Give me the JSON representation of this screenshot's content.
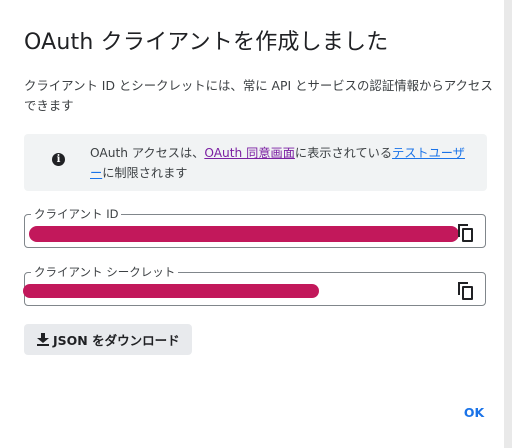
{
  "dialog": {
    "title": "OAuth クライアントを作成しました",
    "description": "クライアント ID とシークレットには、常に API とサービスの認証情報からアクセスできます"
  },
  "banner": {
    "icon": "info-icon",
    "text_before": "OAuth アクセスは、",
    "consent_link": "OAuth 同意画面",
    "text_middle": "に表示されている",
    "test_users_link": "テストユーザー",
    "text_after": "に制限されます",
    "colors": {
      "consent_link": "#7b1fa2",
      "test_users_link": "#1a73e8"
    }
  },
  "client_id": {
    "label": "クライアント ID",
    "value": "",
    "copy_icon": "copy-icon"
  },
  "client_secret": {
    "label": "クライアント シークレット",
    "value": "",
    "copy_icon": "copy-icon"
  },
  "actions": {
    "download_label": "JSON をダウンロード",
    "download_icon": "download-icon",
    "ok_label": "OK"
  },
  "colors": {
    "accent": "#1a73e8",
    "redaction": "#c2185b"
  }
}
